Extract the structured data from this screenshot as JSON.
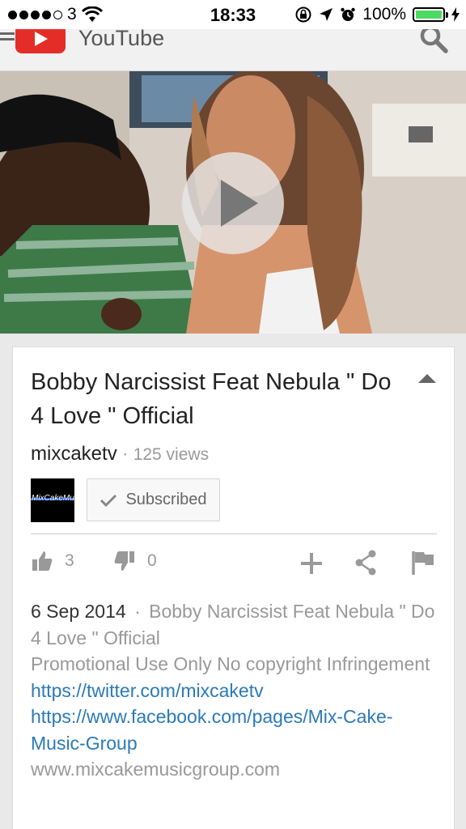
{
  "status_bar": {
    "carrier": "3",
    "time": "18:33",
    "battery": "100%"
  },
  "header": {
    "app_name": "YouTube"
  },
  "video": {
    "title": "Bobby Narcissist Feat Nebula \" Do 4 Love \" Official",
    "channel": "mixcaketv",
    "views": "125 views",
    "avatar_text": "MixCakeMusic",
    "subscribe_label": "Subscribed",
    "likes": "3",
    "dislikes": "0"
  },
  "description": {
    "date": "6 Sep 2014",
    "separator": "·",
    "text_1": "Bobby Narcissist Feat Nebula \" Do 4 Love \" Official",
    "text_2": "Promotional Use Only No copyright Infringement",
    "link_twitter": "https://twitter.com/mixcaketv",
    "link_facebook": "https://www.facebook.com/pages/Mix-Cake-Music-Group",
    "website": "www.mixcakemusicgroup.com"
  },
  "colors": {
    "youtube_red": "#e52d27",
    "link_blue": "#2a7ab8",
    "battery_green": "#4cd964"
  }
}
